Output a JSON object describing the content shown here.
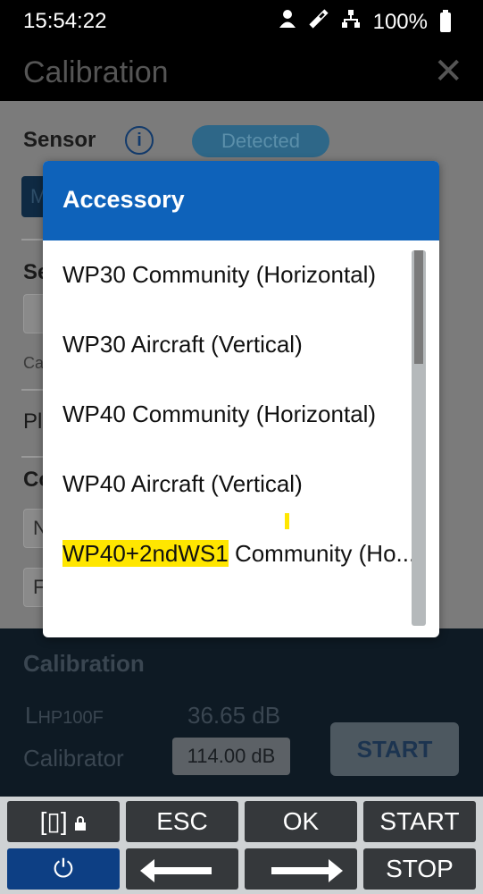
{
  "status_bar": {
    "time": "15:54:22",
    "battery": "100%",
    "icons": [
      "person-icon",
      "calibration-tool-icon",
      "network-icon",
      "battery-icon"
    ]
  },
  "title_bar": {
    "title": "Calibration",
    "close": "✕"
  },
  "background_page": {
    "sensor_label": "Sensor",
    "info_icon": "i",
    "detected_badge": "Detected",
    "sensor_button": "M",
    "section2_partial": "Se",
    "box2_text": "",
    "small_partial": "Ca",
    "row3_partial": "Pl",
    "section3_partial": "Co",
    "box3_text": "N",
    "box4_text": "F"
  },
  "calibration_panel": {
    "heading": "Calibration",
    "level_label_main": "L",
    "level_label_sub": "HP100F",
    "level_value": "36.65 dB",
    "calibrator_label": "Calibrator",
    "calibrator_value": "114.00 dB",
    "start_button": "START"
  },
  "dialog": {
    "title": "Accessory",
    "items": [
      {
        "label": "WP30 Community (Horizontal)"
      },
      {
        "label": "WP30 Aircraft (Vertical)"
      },
      {
        "label": "WP40 Community (Horizontal)"
      },
      {
        "label": "WP40 Aircraft (Vertical)"
      },
      {
        "label_highlight": "WP40+2ndWS1",
        "label_rest": " Community (Ho..."
      }
    ]
  },
  "hardware_keys": {
    "row1": [
      "ESC",
      "OK",
      "START"
    ],
    "row2": [
      "STOP"
    ],
    "power_icon": "⏻",
    "display_lock_icon": "[▯]"
  },
  "colors": {
    "dialog_header": "#0e62ba",
    "highlight": "#ffe600",
    "power_key": "#0d3f84",
    "key": "#35383b"
  }
}
